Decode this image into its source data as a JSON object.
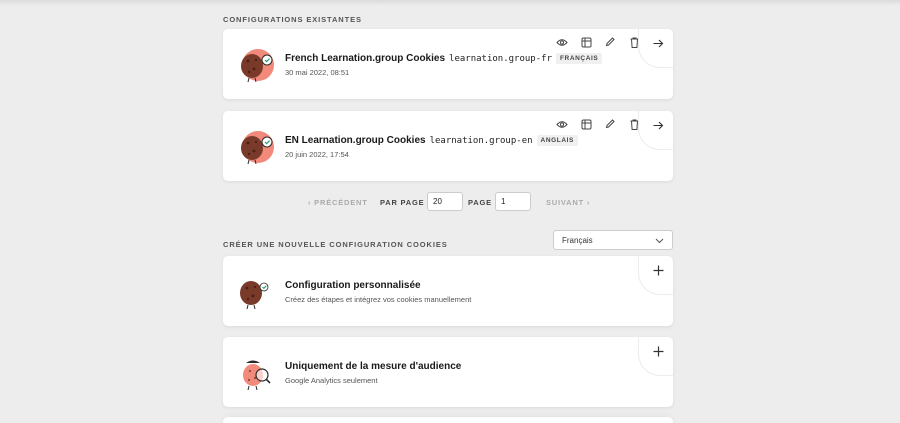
{
  "existing": {
    "section_title": "CONFIGURATIONS EXISTANTES",
    "configs": [
      {
        "name": "French Learnation.group Cookies",
        "slug": "learnation.group-fr",
        "language": "FRANÇAIS",
        "date": "30 mai 2022, 08:51"
      },
      {
        "name": "EN Learnation.group Cookies",
        "slug": "learnation.group-en",
        "language": "ANGLAIS",
        "date": "20 juin 2022, 17:54"
      }
    ]
  },
  "pagination": {
    "previous_label": "‹ PRÉCÉDENT",
    "per_page_label": "PAR PAGE",
    "per_page_value": "20",
    "page_label": "PAGE",
    "page_value": "1",
    "next_label": "SUIVANT ›"
  },
  "create": {
    "section_title": "CRÉER UNE NOUVELLE CONFIGURATION COOKIES",
    "language_select": "Français",
    "options": [
      {
        "title": "Configuration personnalisée",
        "description": "Créez des étapes et intégrez vos cookies manuellement"
      },
      {
        "title": "Uniquement de la mesure d'audience",
        "description": "Google Analytics seulement"
      }
    ]
  },
  "colors": {
    "background": "#ededed",
    "card": "#ffffff",
    "avatar_pink": "#f28a7c",
    "cookie_brown": "#7a3a2a"
  },
  "icons": [
    "eye-icon",
    "duplicate-icon",
    "pencil-icon",
    "trash-icon",
    "arrow-right-icon",
    "plus-icon",
    "chevron-down-icon",
    "cookie-mascot-icon",
    "magnifier-mascot-icon"
  ]
}
